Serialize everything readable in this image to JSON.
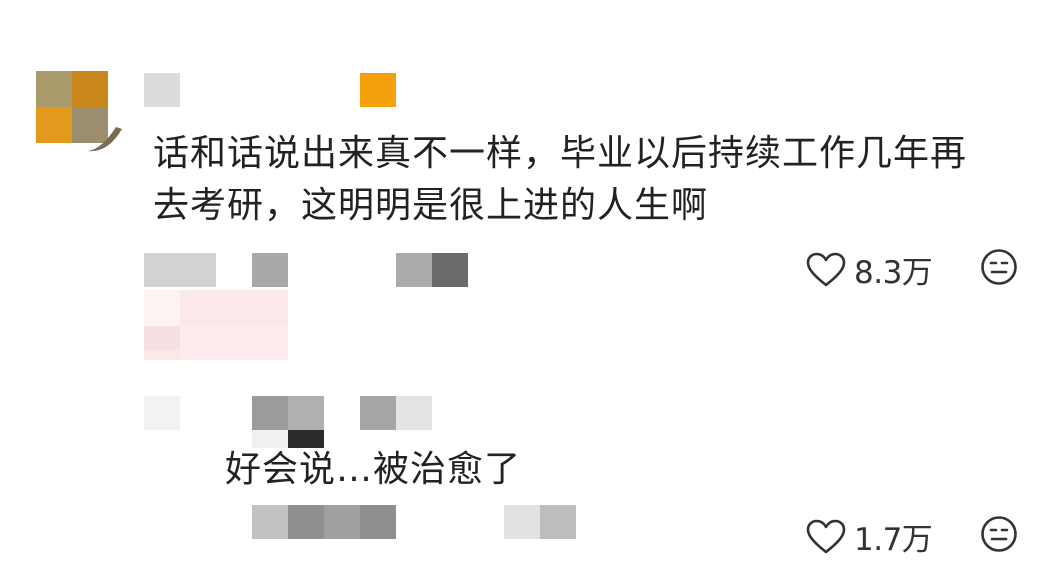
{
  "comment": {
    "text_lines": [
      "话和话说出来真不一样，毕业以后持续工作几年再",
      "去考研，这明明是很上进的人生啊"
    ],
    "like_count": "8.3万"
  },
  "reply": {
    "text": "好会说…被治愈了",
    "like_count": "1.7万"
  },
  "icons": {
    "like": "heart-outline-icon",
    "dislike": "neutral-face-icon"
  },
  "colors": {
    "text": "#222222",
    "meta": "#333333",
    "mosaic_orange": "#f5a10e",
    "mosaic_gray": "#a8a8a8",
    "mosaic_pink": "#fbe9ea"
  }
}
